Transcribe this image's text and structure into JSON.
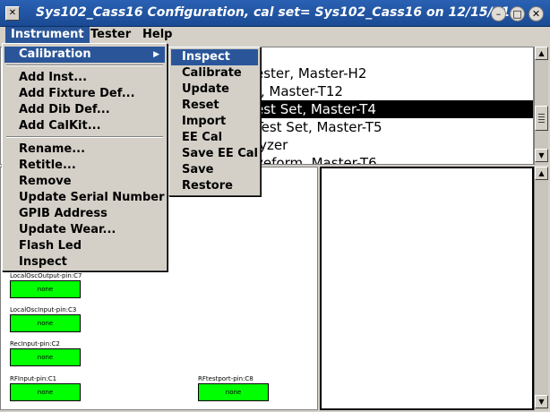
{
  "window": {
    "title": "Sys102_Cass16 Configuration,  cal set= Sys102_Cass16 on 12/15/11",
    "icon_glyph": "✕",
    "minimize_glyph": "–",
    "maximize_glyph": "□",
    "close_glyph": "✕"
  },
  "menubar": {
    "items": [
      {
        "label": "Instrument"
      },
      {
        "label": "Tester"
      },
      {
        "label": "Help"
      }
    ]
  },
  "instrument_menu": {
    "items": [
      {
        "label": "Calibration"
      },
      {
        "label": "Add Inst..."
      },
      {
        "label": "Add Fixture Def..."
      },
      {
        "label": "Add Dib Def..."
      },
      {
        "label": "Add CalKit..."
      },
      {
        "label": "Rename..."
      },
      {
        "label": "Retitle..."
      },
      {
        "label": "Remove"
      },
      {
        "label": "Update Serial Number"
      },
      {
        "label": "GPIB Address"
      },
      {
        "label": "Update Wear..."
      },
      {
        "label": "Flash Led"
      },
      {
        "label": "Inspect"
      }
    ],
    "submenu_arrow": "▶"
  },
  "calibration_menu": {
    "items": [
      {
        "label": "Inspect"
      },
      {
        "label": "Calibrate"
      },
      {
        "label": "Update"
      },
      {
        "label": "Reset"
      },
      {
        "label": "Import"
      },
      {
        "label": "EE Cal"
      },
      {
        "label": "Save EE Cal"
      },
      {
        "label": "Save"
      },
      {
        "label": "Restore"
      }
    ]
  },
  "instrument_list": {
    "rows": [
      {
        "text": "ester, Master-H2"
      },
      {
        "text": "t, Master-T12"
      },
      {
        "text": "est Set, Master-T4"
      },
      {
        "text": "Test Set, Master-T5"
      },
      {
        "text": "lyzer"
      },
      {
        "text": "veform, Master-T6"
      }
    ],
    "selected_index": 2
  },
  "pins": [
    {
      "label": "LocalOscOutput-pin:C7",
      "value": "none"
    },
    {
      "label": "LocalOscInput-pin:C3",
      "value": "none"
    },
    {
      "label": "RecInput-pin:C2",
      "value": "none"
    },
    {
      "label": "RFInput-pin:C1",
      "value": "none"
    },
    {
      "label": "RFtestport-pin:C8",
      "value": "none"
    }
  ],
  "scroll": {
    "up_glyph": "▲",
    "down_glyph": "▼"
  },
  "colors": {
    "menu_highlight": "#2a5699",
    "pin_fill": "#00ff00",
    "titlebar": "#1a4a93"
  }
}
